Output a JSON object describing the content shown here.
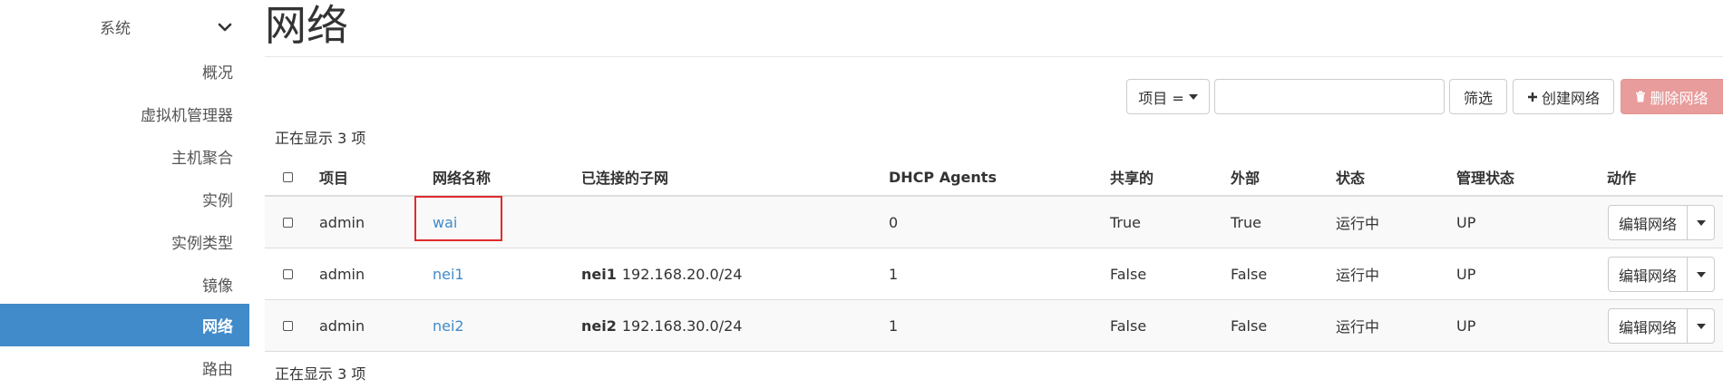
{
  "sidebar": {
    "section_label": "系统",
    "items": [
      {
        "label": "概况"
      },
      {
        "label": "虚拟机管理器"
      },
      {
        "label": "主机聚合"
      },
      {
        "label": "实例"
      },
      {
        "label": "实例类型"
      },
      {
        "label": "镜像"
      },
      {
        "label": "网络",
        "active": true
      },
      {
        "label": "路由"
      }
    ]
  },
  "page": {
    "title": "网络",
    "count_text": "正在显示 3 项",
    "count_text_bottom": "正在显示 3 项"
  },
  "toolbar": {
    "filter_dropdown_label": "项目 =",
    "search_value": "",
    "filter_button": "筛选",
    "create_button": "创建网络",
    "delete_button": "删除网络"
  },
  "table": {
    "headers": {
      "project": "项目",
      "name": "网络名称",
      "subnets": "已连接的子网",
      "dhcp": "DHCP Agents",
      "shared": "共享的",
      "external": "外部",
      "status": "状态",
      "admin_state": "管理状态",
      "actions": "动作"
    },
    "rows": [
      {
        "project": "admin",
        "name": "wai",
        "subnet_name": "",
        "subnet_cidr": "",
        "dhcp": "0",
        "shared": "True",
        "external": "True",
        "status": "运行中",
        "admin_state": "UP",
        "action": "编辑网络"
      },
      {
        "project": "admin",
        "name": "nei1",
        "subnet_name": "nei1",
        "subnet_cidr": "192.168.20.0/24",
        "dhcp": "1",
        "shared": "False",
        "external": "False",
        "status": "运行中",
        "admin_state": "UP",
        "action": "编辑网络"
      },
      {
        "project": "admin",
        "name": "nei2",
        "subnet_name": "nei2",
        "subnet_cidr": "192.168.30.0/24",
        "dhcp": "1",
        "shared": "False",
        "external": "False",
        "status": "运行中",
        "admin_state": "UP",
        "action": "编辑网络"
      }
    ]
  },
  "icons": {
    "plus": "plus-icon",
    "trash": "trash-icon",
    "chevron": "chevron-down-icon"
  },
  "colors": {
    "accent": "#428bca",
    "danger": "#e89c9b",
    "highlight": "#e02b2b"
  }
}
